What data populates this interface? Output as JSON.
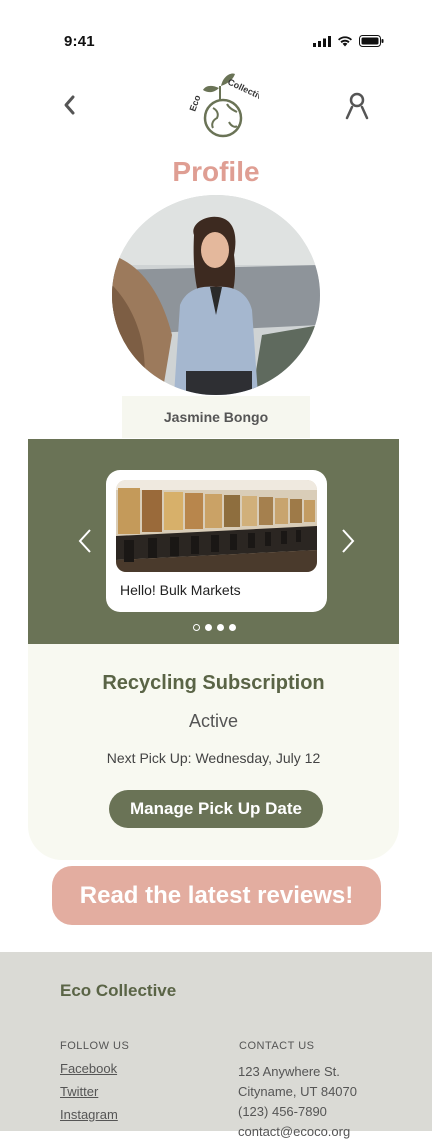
{
  "status_bar": {
    "time": "9:41",
    "icons": [
      "signal-icon",
      "wifi-icon",
      "battery-icon"
    ]
  },
  "header": {
    "logo_text_1": "Eco",
    "logo_text_2": "Collective",
    "back_icon": "chevron-left-icon",
    "user_icon": "user-icon"
  },
  "profile": {
    "title": "Profile",
    "name": "Jasmine Bongo"
  },
  "carousel": {
    "items": [
      {
        "label": "Hello! Bulk Markets"
      }
    ],
    "dots_total": 4,
    "active_dot": 1
  },
  "subscription": {
    "title": "Recycling Subscription",
    "status": "Active",
    "next_pickup": "Next Pick Up: Wednesday,  July 12",
    "manage_label": "Manage Pick Up Date"
  },
  "reviews_label": "Read the latest reviews!",
  "footer": {
    "brand": "Eco Collective",
    "follow_heading": "FOLLOW US",
    "follow_links": [
      "Facebook",
      "Twitter",
      "Instagram"
    ],
    "contact_heading": "CONTACT US",
    "contact_lines": [
      "123 Anywhere St.",
      "Cityname, UT 84070",
      "(123) 456-7890",
      "contact@ecoco.org"
    ]
  },
  "colors": {
    "accent_green": "#6a7356",
    "title_pink": "#df9e93",
    "button_pink": "#e3ada0",
    "footer_bg": "#dadad5"
  }
}
